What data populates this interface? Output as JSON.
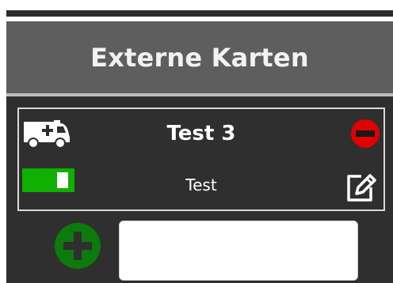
{
  "header": {
    "title": "Externe Karten"
  },
  "card": {
    "icon": "ambulance-icon",
    "title": "Test 3",
    "subtitle": "Test",
    "toggle_on": true,
    "remove_icon": "minus-circle-icon",
    "edit_icon": "edit-icon"
  },
  "add": {
    "icon": "plus-circle-icon",
    "input_value": ""
  },
  "colors": {
    "panel": "#2f2f2f",
    "header": "#5e5e5e",
    "toggle_on": "#0fb000",
    "remove": "#e00000",
    "add": "#0c7a0c"
  }
}
